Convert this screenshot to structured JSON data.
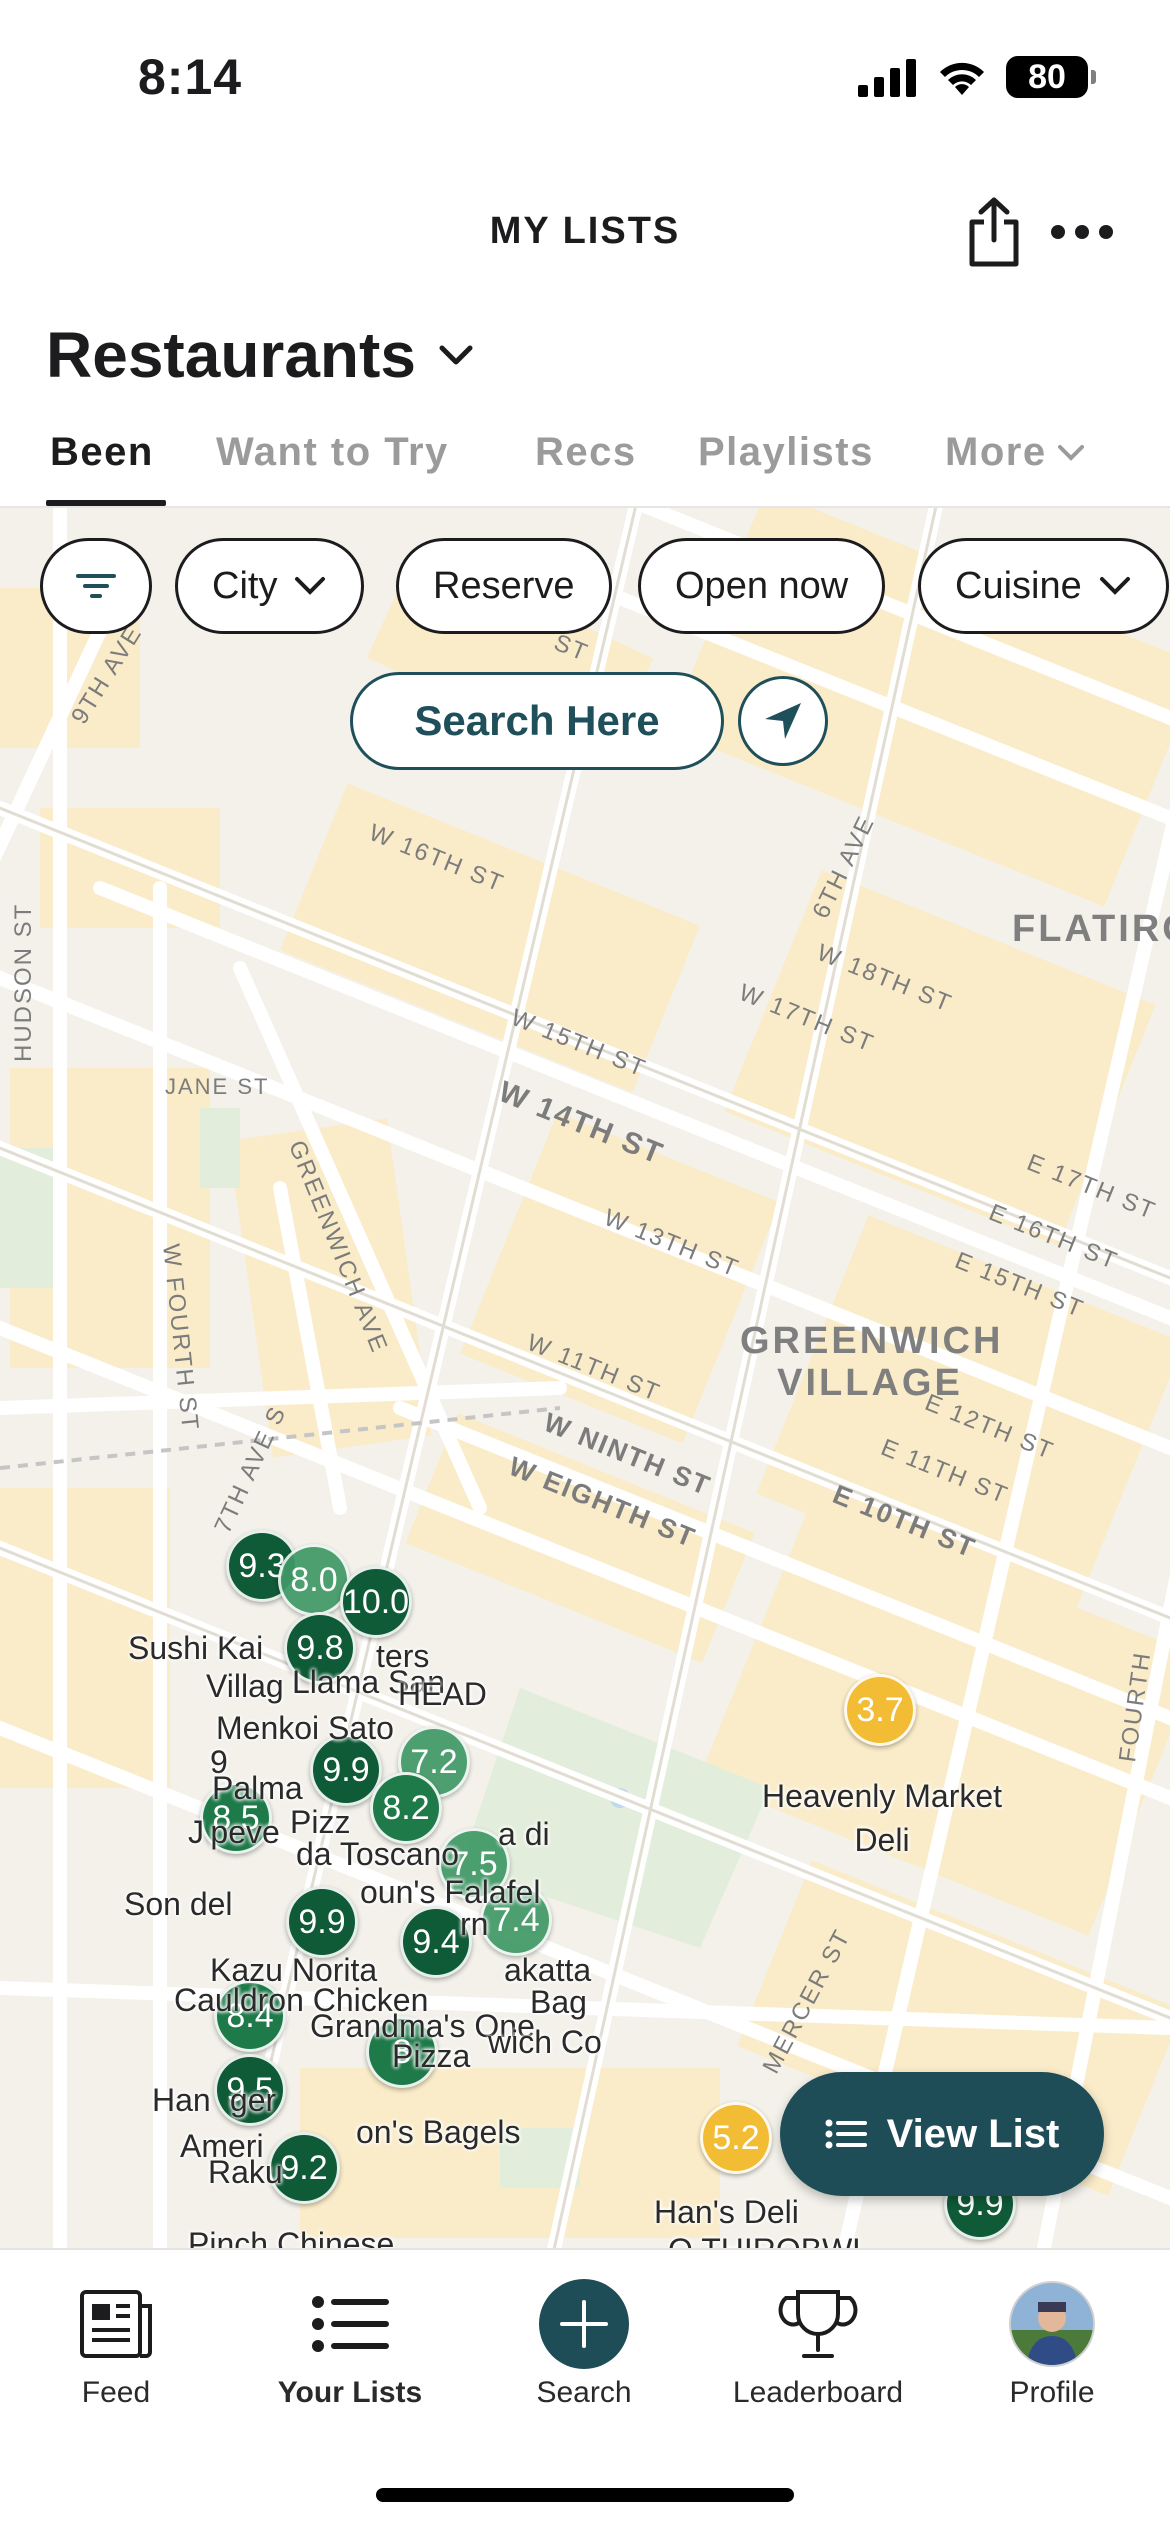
{
  "status": {
    "time": "8:14",
    "battery": "80"
  },
  "header": {
    "title": "MY LISTS",
    "share_icon": "share-icon",
    "more_icon": "more-dots-icon"
  },
  "list": {
    "title": "Restaurants"
  },
  "tabs": [
    {
      "label": "Been"
    },
    {
      "label": "Want to Try"
    },
    {
      "label": "Recs"
    },
    {
      "label": "Playlists"
    },
    {
      "label": "More"
    }
  ],
  "filters": {
    "city": "City",
    "reserve": "Reserve",
    "open_now": "Open now",
    "cuisine": "Cuisine"
  },
  "map": {
    "search_here": "Search Here",
    "streets": {
      "ninth_ave": "9TH AVE",
      "hudson": "HUDSON ST",
      "w16": "W 16TH ST",
      "sixth_ave": "6TH AVE",
      "w18": "W 18TH ST",
      "w17": "W 17TH ST",
      "w15": "W 15TH ST",
      "jane": "JANE ST",
      "w14": "W 14TH ST",
      "greenwich_ave": "GREENWICH AVE",
      "w13": "W 13TH ST",
      "e17": "E 17TH ST",
      "e16": "E 16TH ST",
      "e15": "E 15TH ST",
      "w_fourth": "W FOURTH ST",
      "w11": "W 11TH ST",
      "seventh_ave": "7TH AVE S",
      "w_ninth": "W NINTH ST",
      "w_eighth": "W EIGHTH ST",
      "e12": "E 12TH ST",
      "e11": "E 11TH ST",
      "e10": "E 10TH ST",
      "mercer": "MERCER ST",
      "fourth": "FOURTH",
      "st": "ST"
    },
    "areas": {
      "flatiron": "FLATIRO",
      "greenwich_village": "GREENWICH VILLAGE"
    },
    "pins": [
      {
        "score": "9.3",
        "color": "dark"
      },
      {
        "score": "8.0",
        "color": "light"
      },
      {
        "score": "10.0",
        "color": "dark"
      },
      {
        "score": "9.8",
        "color": "dark"
      },
      {
        "score": "9.9",
        "color": "dark"
      },
      {
        "score": "7.2",
        "color": "light"
      },
      {
        "score": "8.2",
        "color": "green"
      },
      {
        "score": "8.5",
        "color": "green"
      },
      {
        "score": "7.5",
        "color": "light"
      },
      {
        "score": "9.9",
        "color": "dark"
      },
      {
        "score": "9.4",
        "color": "dark"
      },
      {
        "score": "7.4",
        "color": "light"
      },
      {
        "score": "8.4",
        "color": "green"
      },
      {
        "score": "8",
        "color": "green"
      },
      {
        "score": "9.5",
        "color": "dark"
      },
      {
        "score": "9.2",
        "color": "dark"
      },
      {
        "score": "3.7",
        "color": "yellow"
      },
      {
        "score": "5.2",
        "color": "yellow"
      },
      {
        "score": "9.9",
        "color": "dark"
      }
    ],
    "labels": {
      "sushi_kai": "Sushi Kai",
      "village": "Villag",
      "llama_san": "Llama San",
      "ters": "ters",
      "head": "HEAD",
      "menkoi": "Menkoi Sato",
      "nine": "9",
      "palma": "Palma",
      "peve": "J peve",
      "toscano": "da Toscano",
      "pizza_mid": "Pizz",
      "di": "a di",
      "son": "Son del",
      "falafel": "oun's Falafel",
      "rn": "rn",
      "kazu": "Kazu Norita",
      "cauldron": "Cauldron Chicken",
      "akatta": "akatta",
      "bag": "Bag",
      "grandmas": "Grandma's One",
      "pizza": "Pizza",
      "wich": "wich Co",
      "hamburger": "Han   ger",
      "ameri": "Ameri",
      "bagels": "on's Bagels",
      "raku": "Raku",
      "pinch": "Pinch Chinese",
      "heavenly": "Heavenly Market Deli",
      "hans": "Han's Deli",
      "thirobwl": "Q THIROBWL"
    },
    "view_list": "View List"
  },
  "nav": [
    {
      "label": "Feed",
      "icon": "newspaper-icon"
    },
    {
      "label": "Your Lists",
      "icon": "list-icon"
    },
    {
      "label": "Search",
      "icon": "plus-icon"
    },
    {
      "label": "Leaderboard",
      "icon": "trophy-icon"
    },
    {
      "label": "Profile",
      "icon": "avatar"
    }
  ]
}
